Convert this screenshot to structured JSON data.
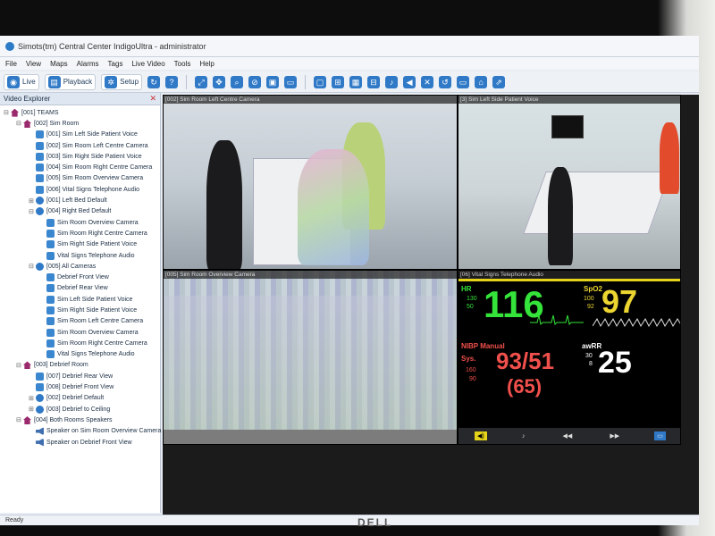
{
  "window": {
    "title": "Simots(tm) Central Center IndigoUltra - administrator"
  },
  "menu": [
    "File",
    "View",
    "Maps",
    "Alarms",
    "Tags",
    "Live Video",
    "Tools",
    "Help"
  ],
  "toolbar": {
    "live_label": "Live",
    "playback_label": "Playback",
    "setup_label": "Setup"
  },
  "explorer": {
    "title": "Video Explorer",
    "nodes": [
      "[001] TEAMS",
      "[002] Sim Room",
      "[001] Sim Left Side Patient Voice",
      "[002] Sim Room Left Centre Camera",
      "[003] Sim Right Side Patient Voice",
      "[004] Sim Room Right Centre Camera",
      "[005] Sim Room Overview Camera",
      "[006] Vital Signs Telephone Audio",
      "[001] Left Bed Default",
      "[004] Right Bed Default",
      "Sim Room Overview Camera",
      "Sim Room Right Centre Camera",
      "Sim Right Side Patient Voice",
      "Vital Signs Telephone Audio",
      "[005] All Cameras",
      "Debrief Front View",
      "Debrief Rear View",
      "Sim Left Side Patient Voice",
      "Sim Right Side Patient Voice",
      "Sim Room Left Centre Camera",
      "Sim Room Overview Camera",
      "Sim Room Right Centre Camera",
      "Vital Signs Telephone Audio",
      "[003] Debrief Room",
      "[007] Debrief Rear View",
      "[008] Debrief Front View",
      "[002] Debrief Default",
      "[003] Debrief to Ceiling",
      "[004] Both Rooms Speakers",
      "Speaker on Sim Room Overview Camera",
      "Speaker on Debrief Front View"
    ]
  },
  "tiles": {
    "t1": "[002] Sim Room Left Centre Camera",
    "t2": "[3] Sim Left Side Patient Voice",
    "t3": "[005] Sim Room Overview Camera",
    "t4": "[06] Vital Signs Telephone Audio"
  },
  "vitals": {
    "hr_label": "HR",
    "hr_value": "116",
    "hr_hi": "130",
    "hr_lo": "50",
    "spo2_label": "SpO2",
    "spo2_value": "97",
    "spo2_hi": "100",
    "spo2_lo": "92",
    "nibp_label": "NIBP Manual",
    "sys_label": "Sys.",
    "sys_hi": "160",
    "sys_lo": "90",
    "nibp_value": "93/51",
    "map_value": "(65)",
    "awrr_label": "awRR",
    "awrr_hi": "30",
    "awrr_lo": "8",
    "awrr_value": "25"
  },
  "status": {
    "text": "Ready"
  },
  "brand": "DELL"
}
